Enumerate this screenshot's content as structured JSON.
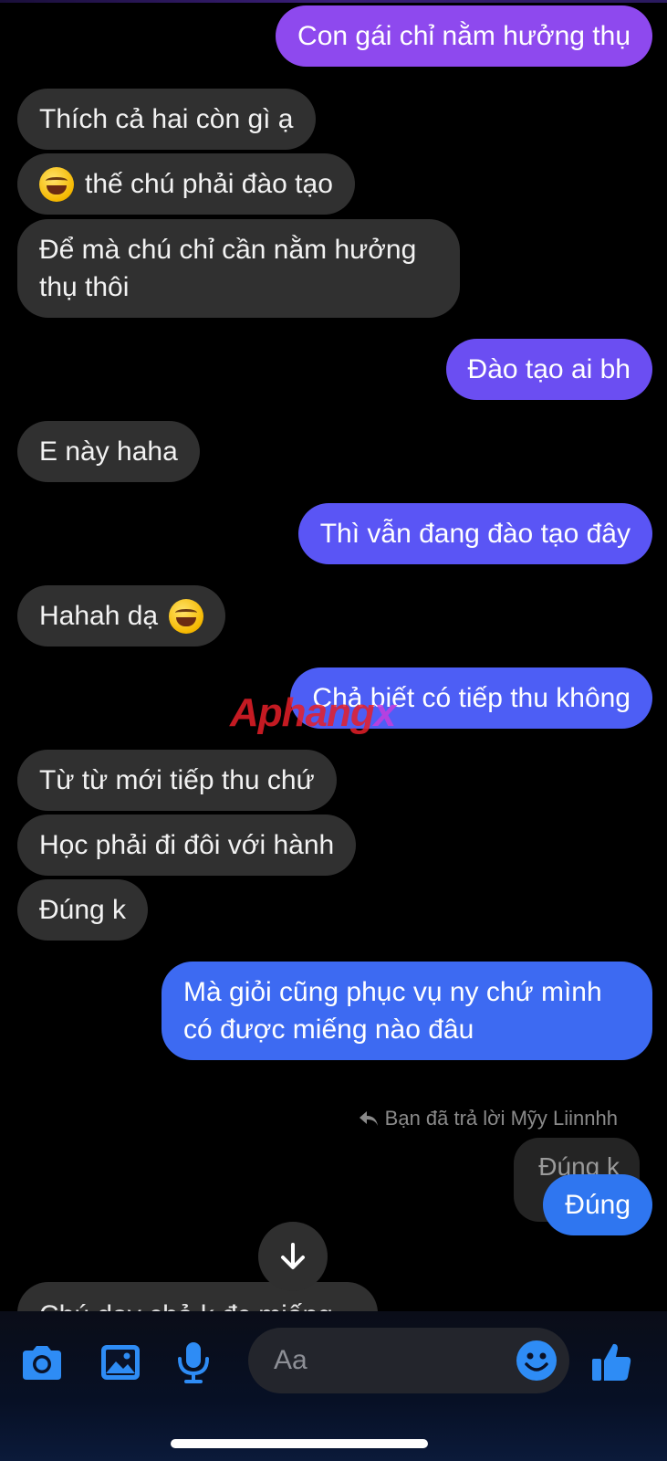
{
  "messages": [
    {
      "id": "m1",
      "side": "out",
      "text": "Con gái chỉ nằm hưởng thụ",
      "color": "#8e49ee"
    },
    {
      "id": "m2",
      "side": "in",
      "text": "Thích cả hai còn gì ạ"
    },
    {
      "id": "m3",
      "side": "in",
      "text": "thế chú phải đào tạo",
      "emoji": "rolling-on-floor-laughing-emoji"
    },
    {
      "id": "m4",
      "side": "in",
      "text": "Để mà chú chỉ cần nằm hưởng thụ thôi"
    },
    {
      "id": "m5",
      "side": "out",
      "text": "Đào tạo ai bh",
      "color": "#6b4ef2"
    },
    {
      "id": "m6",
      "side": "in",
      "text": "E này haha"
    },
    {
      "id": "m7",
      "side": "out",
      "text": "Thì vẫn đang đào tạo đây",
      "color": "#5a55f5"
    },
    {
      "id": "m8",
      "side": "in",
      "text": "Hahah dạ",
      "emoji": "tears-of-joy-emoji"
    },
    {
      "id": "m9",
      "side": "out",
      "text": "Chả biết có tiếp thu không",
      "color": "#4d5ef5"
    },
    {
      "id": "m10",
      "side": "in",
      "text": "Từ từ mới tiếp thu chứ"
    },
    {
      "id": "m11",
      "side": "in",
      "text": "Học phải đi đôi với hành"
    },
    {
      "id": "m12",
      "side": "in",
      "text": "Đúng k"
    },
    {
      "id": "m13",
      "side": "out",
      "text": "Mà giỏi cũng phục vụ ny chứ mình có được miếng nào đâu",
      "color": "#3d6af2"
    },
    {
      "id": "m14",
      "side": "out",
      "text": "Đúng",
      "color": "#2f76f0"
    }
  ],
  "watermark": {
    "part1": "Aphang",
    "part2": "x"
  },
  "reply": {
    "note": "Bạn đã trả lời Mỹy Liinnhh",
    "quoted_text": "Đúng k"
  },
  "partial_message": "Chú dạy chả k đc miếng",
  "composer": {
    "placeholder": "Aa",
    "icons": [
      "camera-icon",
      "image-icon",
      "microphone-icon",
      "emoji-icon",
      "thumbs-up-icon"
    ],
    "accent": "#2e8cf5"
  },
  "scroll_icon": "arrow-down-icon"
}
